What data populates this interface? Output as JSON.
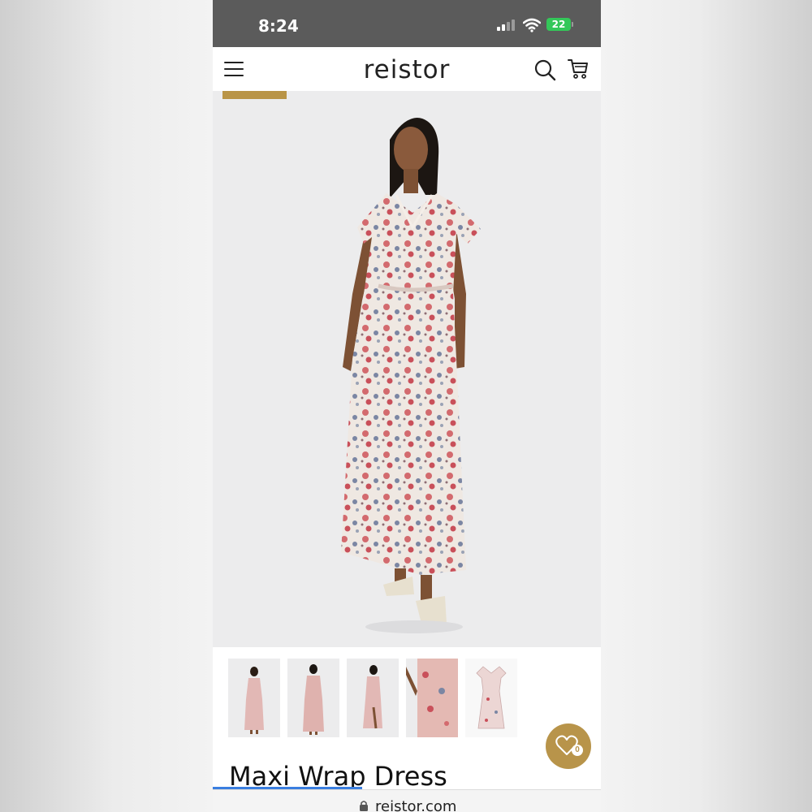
{
  "status_bar": {
    "time": "8:24",
    "battery": "22"
  },
  "header": {
    "logo": "reistor"
  },
  "product": {
    "title": "Maxi Wrap Dress"
  },
  "gallery": {
    "thumbnails": [
      "front view",
      "back view",
      "side slit view",
      "detail view",
      "flat lay"
    ],
    "selected_index": 0
  },
  "wishlist": {
    "count": "0"
  },
  "browser": {
    "url": "reistor.com"
  },
  "colors": {
    "accent": "#b8944a",
    "status_bar": "#5b5b5b",
    "battery": "#34c759",
    "progress": "#3a7ee0"
  }
}
